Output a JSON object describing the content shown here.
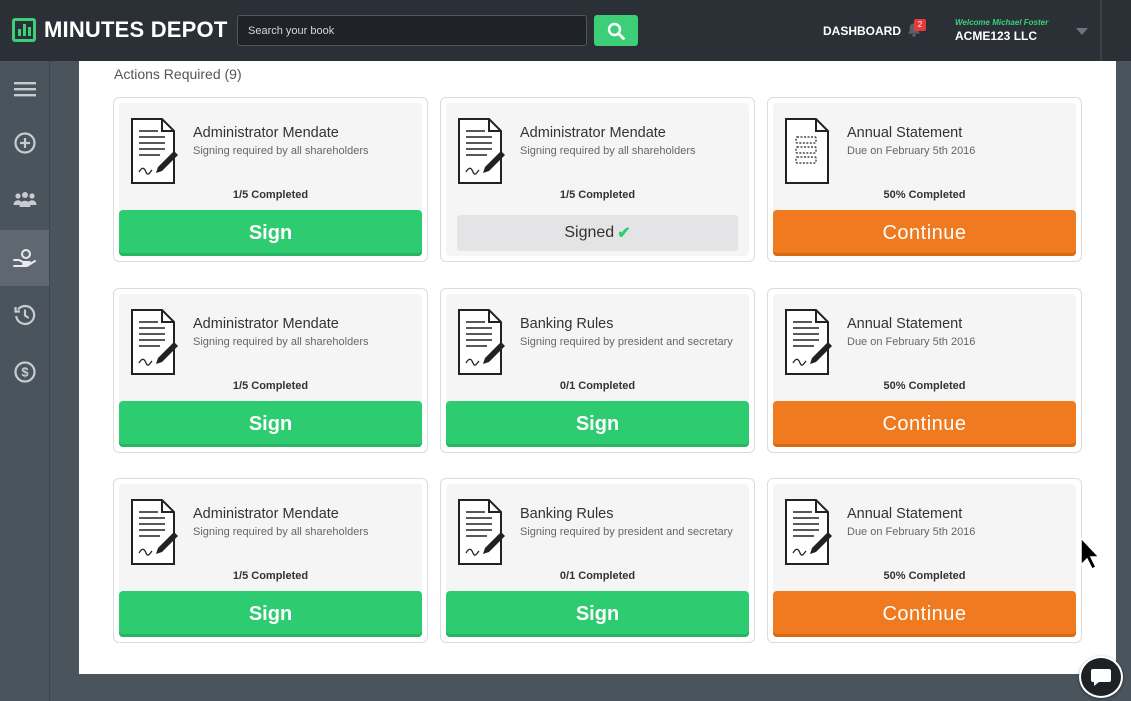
{
  "app": {
    "name": "MINUTES DEPOT",
    "logo_icon": "bar-chart-book-icon",
    "brand_color": "#3ccf78"
  },
  "header": {
    "search_placeholder": "Search your book",
    "search_icon": "search-icon",
    "dashboard_label": "DASHBOARD",
    "notifications_count": "2",
    "welcome_text": "Welcome Michael Foster",
    "company_name": "ACME123 LLC"
  },
  "sidebar": {
    "items": [
      {
        "icon": "menu-icon"
      },
      {
        "icon": "add-circle-icon"
      },
      {
        "icon": "people-icon"
      },
      {
        "icon": "hand-coin-icon",
        "active": true
      },
      {
        "icon": "history-icon"
      },
      {
        "icon": "dollar-circle-icon"
      }
    ]
  },
  "main": {
    "section_title": "Actions Required (9)",
    "cards": [
      {
        "title": "Administrator Mendate",
        "subtitle": "Signing required by all shareholders",
        "progress": "1/5 Completed",
        "action": "Sign",
        "type": "sign"
      },
      {
        "title": "Administrator Mendate",
        "subtitle": "Signing required by all shareholders",
        "progress": "1/5 Completed",
        "action": "Signed",
        "type": "signed"
      },
      {
        "title": "Annual Statement",
        "subtitle": "Due on February 5th 2016",
        "progress": "50% Completed",
        "action": "Continue",
        "type": "continue",
        "icon_variant": "form"
      },
      {
        "title": "Administrator Mendate",
        "subtitle": "Signing required by all shareholders",
        "progress": "1/5 Completed",
        "action": "Sign",
        "type": "sign"
      },
      {
        "title": "Banking Rules",
        "subtitle": "Signing required by president and secretary",
        "progress": "0/1 Completed",
        "action": "Sign",
        "type": "sign"
      },
      {
        "title": "Annual Statement",
        "subtitle": "Due on February 5th 2016",
        "progress": "50% Completed",
        "action": "Continue",
        "type": "continue"
      },
      {
        "title": "Administrator Mendate",
        "subtitle": "Signing required by all shareholders",
        "progress": "1/5 Completed",
        "action": "Sign",
        "type": "sign"
      },
      {
        "title": "Banking Rules",
        "subtitle": "Signing required by president and secretary",
        "progress": "0/1 Completed",
        "action": "Sign",
        "type": "sign"
      },
      {
        "title": "Annual Statement",
        "subtitle": "Due on February 5th 2016",
        "progress": "50% Completed",
        "action": "Continue",
        "type": "continue"
      }
    ]
  },
  "colors": {
    "sign": "#2ecc71",
    "continue": "#f07a1f",
    "signed_bg": "#e4e4e6",
    "topbar": "#2b3036",
    "sidebar": "#4a545c"
  },
  "chat": {
    "icon": "chat-bubble-icon"
  }
}
